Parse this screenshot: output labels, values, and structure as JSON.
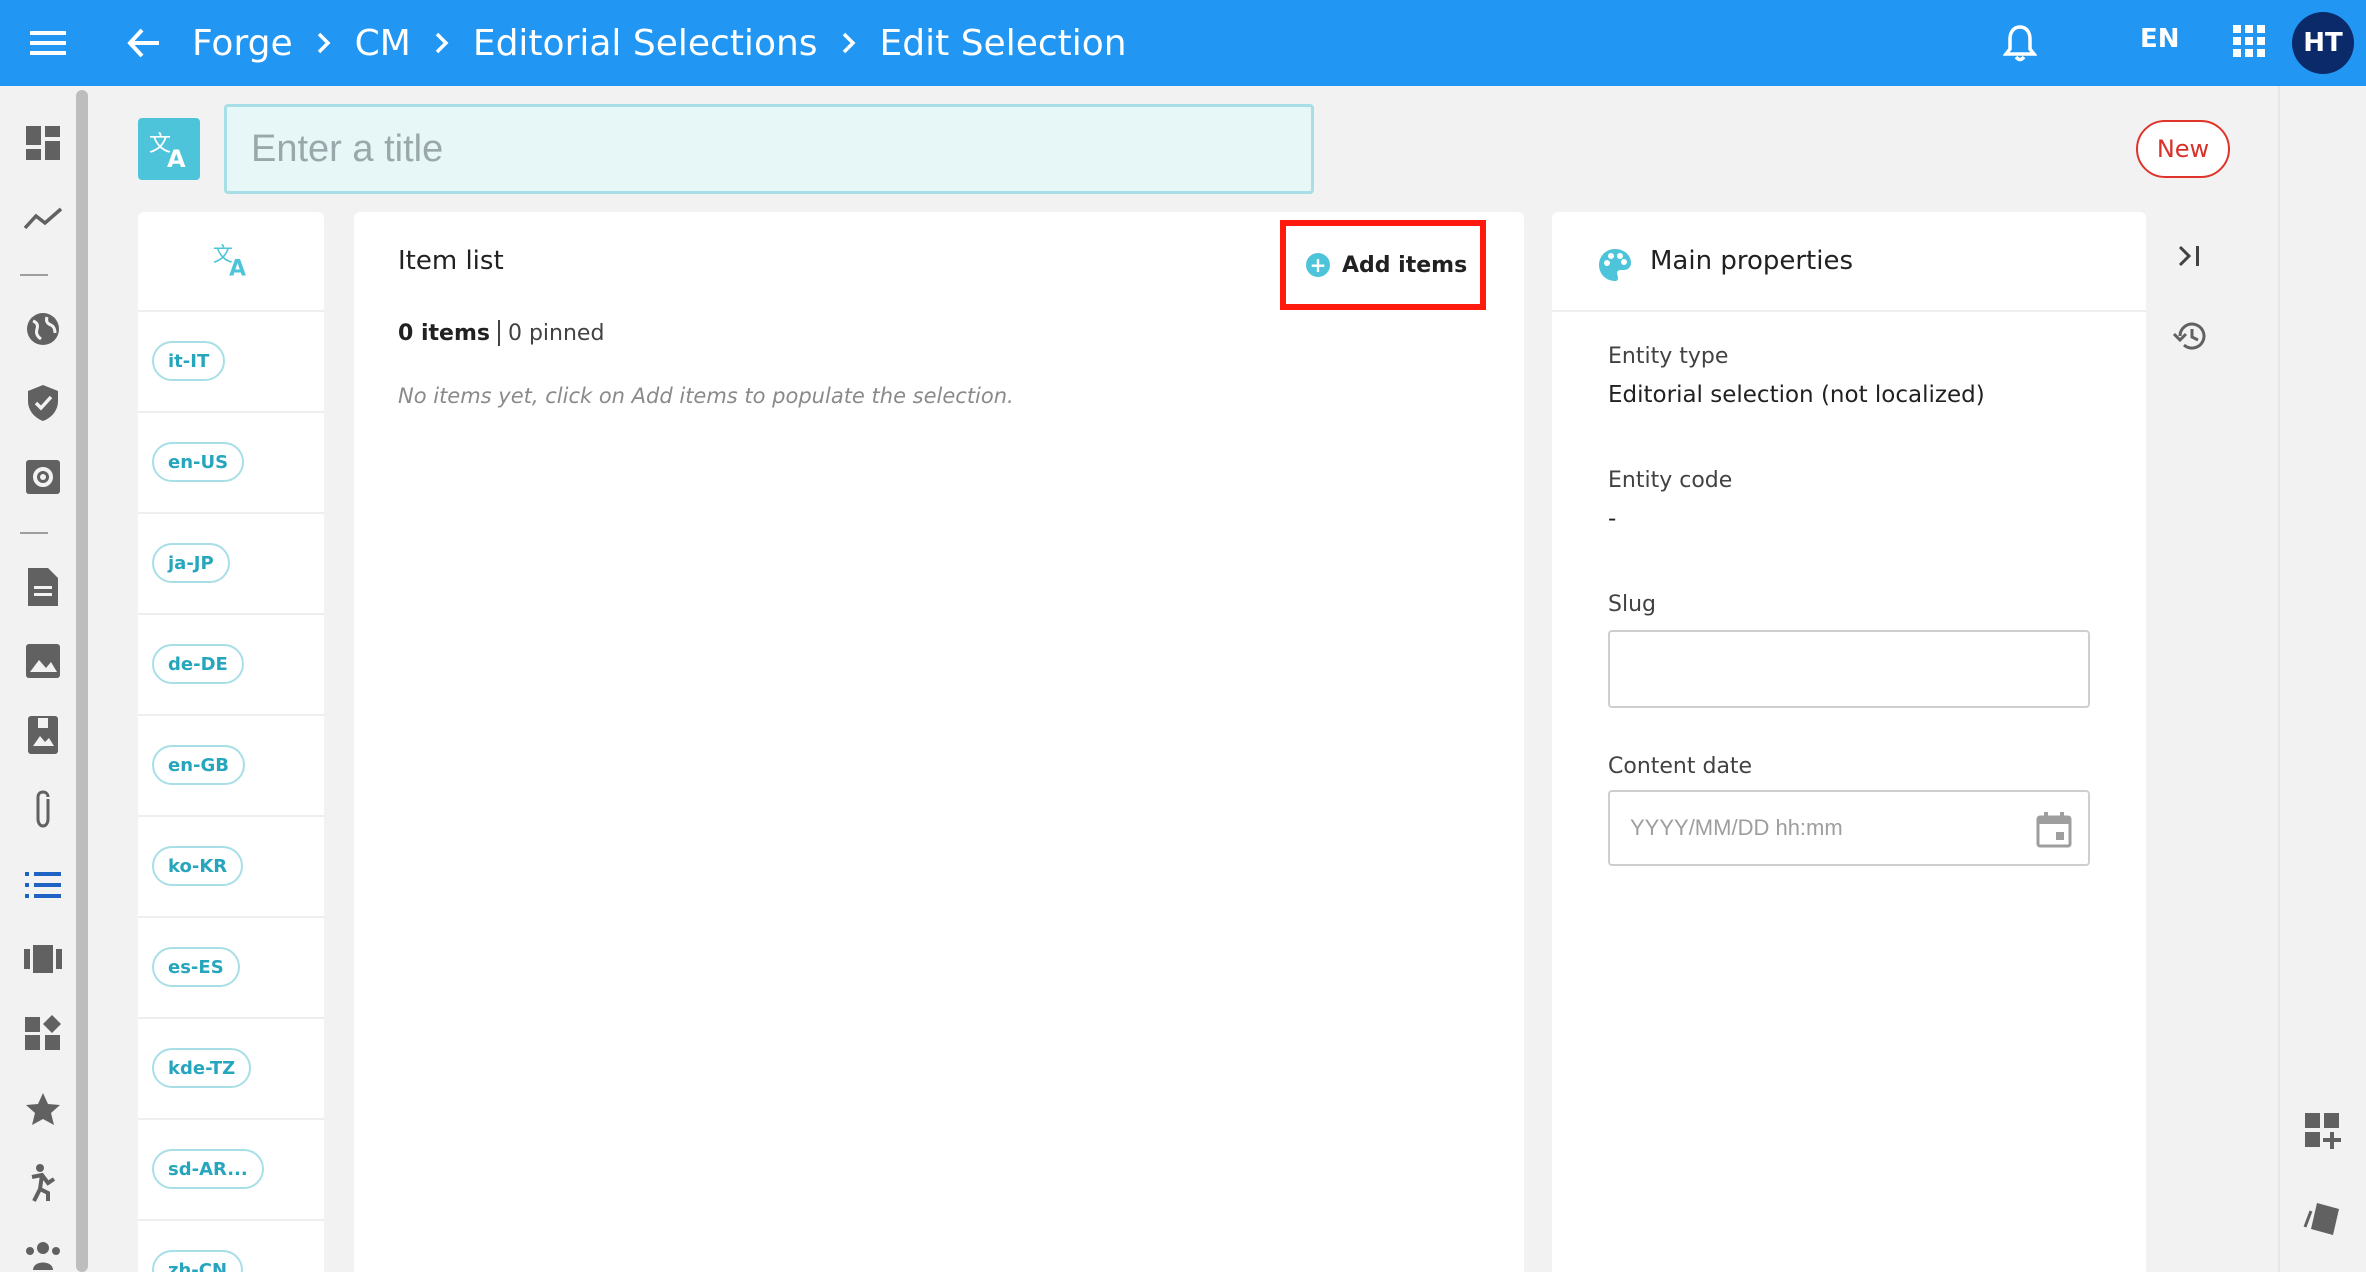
{
  "header": {
    "breadcrumbs": [
      "Forge",
      "CM",
      "Editorial Selections",
      "Edit Selection"
    ],
    "language": "EN",
    "avatar_initials": "HT",
    "color": "#2196f3"
  },
  "title": {
    "placeholder": "Enter a title",
    "badge": "New"
  },
  "left_nav": {
    "icons": [
      "dashboard-icon",
      "trend-icon",
      "globe-icon",
      "shield-icon",
      "settings-box-icon",
      "document-icon",
      "image-icon",
      "photo-album-icon",
      "paperclip-icon",
      "list-icon",
      "carousel-icon",
      "widgets-icon",
      "star-icon",
      "person-icon",
      "group-icon"
    ]
  },
  "locales": [
    "it-IT",
    "en-US",
    "ja-JP",
    "de-DE",
    "en-GB",
    "ko-KR",
    "es-ES",
    "kde-TZ",
    "sd-AR...",
    "zh-CN"
  ],
  "item_list": {
    "title": "Item list",
    "add_button": "Add items",
    "items_count": "0 items",
    "pinned_count": "0 pinned",
    "empty_message": "No items yet, click on Add items to populate the selection."
  },
  "properties": {
    "title": "Main properties",
    "entity_type_label": "Entity type",
    "entity_type_value": "Editorial selection (not localized)",
    "entity_code_label": "Entity code",
    "entity_code_value": "-",
    "slug_label": "Slug",
    "slug_value": "",
    "content_date_label": "Content date",
    "content_date_placeholder": "YYYY/MM/DD hh:mm"
  },
  "accent_color": "#4dc4d9"
}
